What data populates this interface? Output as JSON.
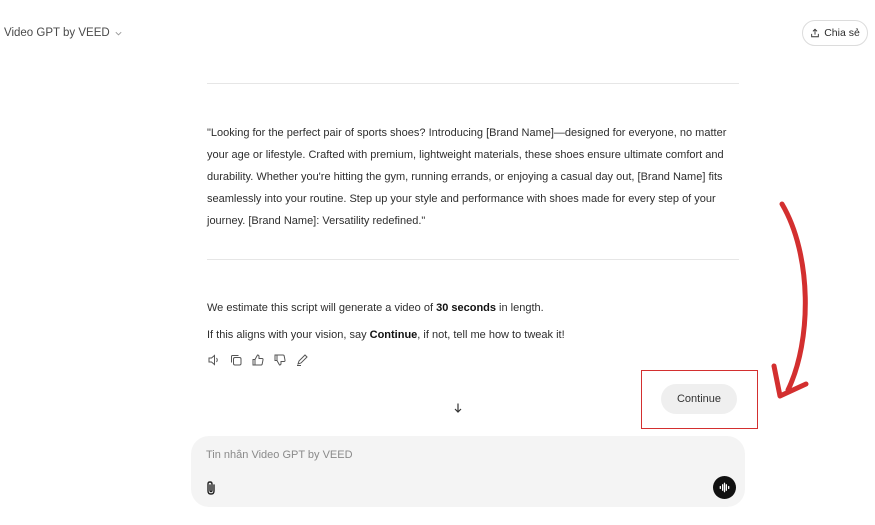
{
  "header": {
    "app_title": "Video GPT by VEED",
    "share_label": "Chia sẻ",
    "icons": {
      "title_dropdown": "chevron-down-icon",
      "share": "share-icon"
    }
  },
  "message": {
    "quote": "\"Looking for the perfect pair of sports shoes? Introducing [Brand Name]—designed for everyone, no matter your age or lifestyle. Crafted with premium, lightweight materials, these shoes ensure ultimate comfort and durability. Whether you're hitting the gym, running errands, or enjoying a casual day out, [Brand Name] fits seamlessly into your routine. Step up your style and performance with shoes made for every step of your journey. [Brand Name]: Versatility redefined.\"",
    "estimate": {
      "before": "We estimate this script will generate a video of ",
      "bold": "30 seconds",
      "after": " in length."
    },
    "align": {
      "before": "If this aligns with your vision, say ",
      "bold": "Continue",
      "after": ", if not, tell me how to tweak it!"
    },
    "action_icons": [
      "speaker-icon",
      "copy-icon",
      "thumbs-up-icon",
      "thumbs-down-icon",
      "edit-icon"
    ]
  },
  "continue_label": "Continue",
  "composer": {
    "placeholder": "Tin nhắn Video GPT by VEED",
    "icons": {
      "attach": "paperclip-icon",
      "voice": "voice-icon"
    }
  },
  "colors": {
    "highlight": "#d32f2f",
    "voice_button": "#111111",
    "composer_bg": "#f4f4f4"
  }
}
